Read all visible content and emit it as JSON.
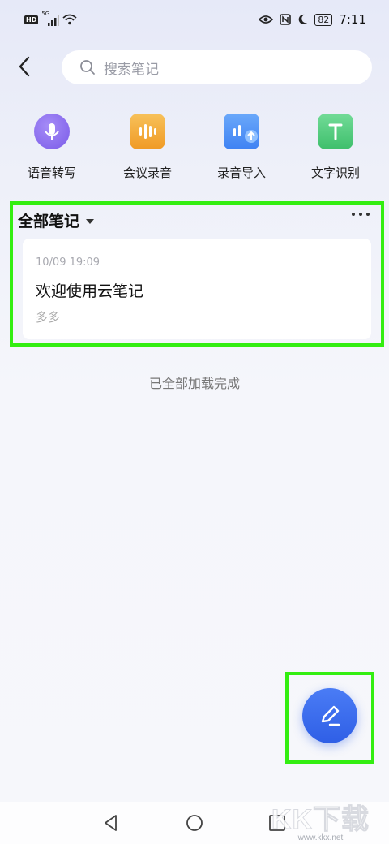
{
  "status_bar": {
    "hd_label": "HD",
    "network_label": "5G",
    "battery": "82",
    "time": "7:11"
  },
  "header": {
    "back_icon": "chevron-left-icon",
    "search_placeholder": "搜索笔记"
  },
  "tools": [
    {
      "label": "语音转写",
      "icon": "microphone-icon",
      "color": "#8a6cf0"
    },
    {
      "label": "会议录音",
      "icon": "audio-wave-icon",
      "color": "#f3a52b"
    },
    {
      "label": "录音导入",
      "icon": "folder-import-icon",
      "color": "#4a8df5"
    },
    {
      "label": "文字识别",
      "icon": "text-recognition-icon",
      "color": "#4cc77a"
    }
  ],
  "notes_section": {
    "title": "全部笔记",
    "notes": [
      {
        "date": "10/09 19:09",
        "title": "欢迎使用云笔记",
        "preview": "多多"
      }
    ],
    "footer": "已全部加载完成"
  },
  "watermark": {
    "logo_text": "KK下载",
    "url": "www.kkx.net"
  },
  "colors": {
    "accent": "#3565e8",
    "highlight": "#33ee11"
  }
}
